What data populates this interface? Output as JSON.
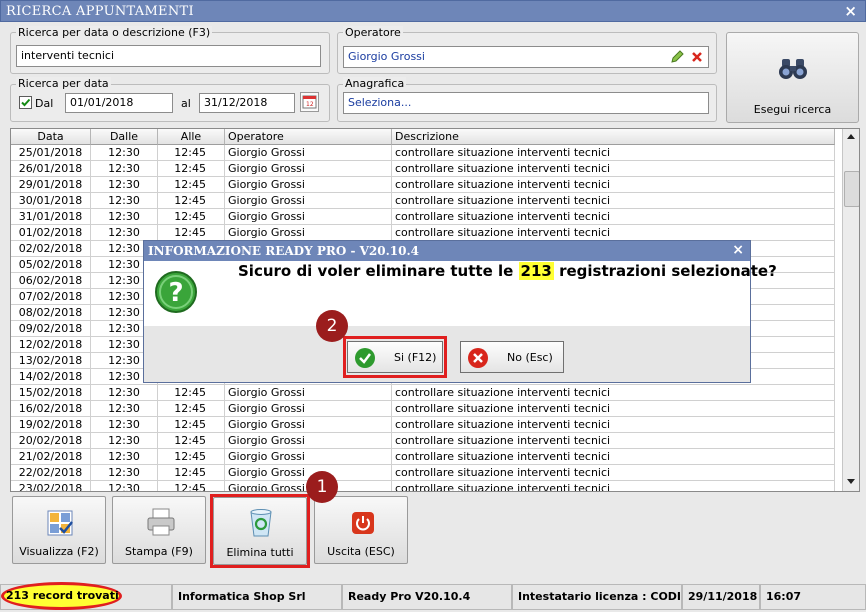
{
  "window": {
    "title": "RICERCA APPUNTAMENTI",
    "close": "×"
  },
  "search": {
    "desc_group_label": "Ricerca per data o descrizione (F3)",
    "desc_value": "interventi tecnici",
    "date_group_label": "Ricerca per data",
    "dal_label": "Dal",
    "dal_checked": true,
    "from_date": "01/01/2018",
    "al_label": "al",
    "to_date": "31/12/2018",
    "operator_group_label": "Operatore",
    "operator_value": "Giorgio Grossi",
    "anagrafica_group_label": "Anagrafica",
    "anagrafica_value": "Seleziona...",
    "execute_label": "Esegui ricerca"
  },
  "grid": {
    "columns": [
      "Data",
      "Dalle",
      "Alle",
      "Operatore",
      "Descrizione"
    ],
    "rows": [
      {
        "data": "25/01/2018",
        "dalle": "12:30",
        "alle": "12:45",
        "operatore": "Giorgio Grossi",
        "descrizione": "controllare situazione interventi tecnici"
      },
      {
        "data": "26/01/2018",
        "dalle": "12:30",
        "alle": "12:45",
        "operatore": "Giorgio Grossi",
        "descrizione": "controllare situazione interventi tecnici"
      },
      {
        "data": "29/01/2018",
        "dalle": "12:30",
        "alle": "12:45",
        "operatore": "Giorgio Grossi",
        "descrizione": "controllare situazione interventi tecnici"
      },
      {
        "data": "30/01/2018",
        "dalle": "12:30",
        "alle": "12:45",
        "operatore": "Giorgio Grossi",
        "descrizione": "controllare situazione interventi tecnici"
      },
      {
        "data": "31/01/2018",
        "dalle": "12:30",
        "alle": "12:45",
        "operatore": "Giorgio Grossi",
        "descrizione": "controllare situazione interventi tecnici"
      },
      {
        "data": "01/02/2018",
        "dalle": "12:30",
        "alle": "12:45",
        "operatore": "Giorgio Grossi",
        "descrizione": "controllare situazione interventi tecnici"
      },
      {
        "data": "02/02/2018",
        "dalle": "12:30",
        "alle": "",
        "operatore": "",
        "descrizione": ""
      },
      {
        "data": "05/02/2018",
        "dalle": "12:30",
        "alle": "",
        "operatore": "",
        "descrizione": ""
      },
      {
        "data": "06/02/2018",
        "dalle": "12:30",
        "alle": "",
        "operatore": "",
        "descrizione": ""
      },
      {
        "data": "07/02/2018",
        "dalle": "12:30",
        "alle": "",
        "operatore": "",
        "descrizione": ""
      },
      {
        "data": "08/02/2018",
        "dalle": "12:30",
        "alle": "",
        "operatore": "",
        "descrizione": ""
      },
      {
        "data": "09/02/2018",
        "dalle": "12:30",
        "alle": "",
        "operatore": "",
        "descrizione": ""
      },
      {
        "data": "12/02/2018",
        "dalle": "12:30",
        "alle": "",
        "operatore": "",
        "descrizione": ""
      },
      {
        "data": "13/02/2018",
        "dalle": "12:30",
        "alle": "",
        "operatore": "",
        "descrizione": ""
      },
      {
        "data": "14/02/2018",
        "dalle": "12:30",
        "alle": "",
        "operatore": "",
        "descrizione": ""
      },
      {
        "data": "15/02/2018",
        "dalle": "12:30",
        "alle": "12:45",
        "operatore": "Giorgio Grossi",
        "descrizione": "controllare situazione interventi tecnici"
      },
      {
        "data": "16/02/2018",
        "dalle": "12:30",
        "alle": "12:45",
        "operatore": "Giorgio Grossi",
        "descrizione": "controllare situazione interventi tecnici"
      },
      {
        "data": "19/02/2018",
        "dalle": "12:30",
        "alle": "12:45",
        "operatore": "Giorgio Grossi",
        "descrizione": "controllare situazione interventi tecnici"
      },
      {
        "data": "20/02/2018",
        "dalle": "12:30",
        "alle": "12:45",
        "operatore": "Giorgio Grossi",
        "descrizione": "controllare situazione interventi tecnici"
      },
      {
        "data": "21/02/2018",
        "dalle": "12:30",
        "alle": "12:45",
        "operatore": "Giorgio Grossi",
        "descrizione": "controllare situazione interventi tecnici"
      },
      {
        "data": "22/02/2018",
        "dalle": "12:30",
        "alle": "12:45",
        "operatore": "Giorgio Grossi",
        "descrizione": "controllare situazione interventi tecnici"
      },
      {
        "data": "23/02/2018",
        "dalle": "12:30",
        "alle": "12:45",
        "operatore": "Giorgio Grossi",
        "descrizione": "controllare situazione interventi tecnici"
      }
    ]
  },
  "dialog": {
    "title": "INFORMAZIONE READY PRO - V20.10.4",
    "close": "×",
    "message_before": "Sicuro di voler eliminare tutte le",
    "message_count": "213",
    "message_after": "registrazioni selezionate?",
    "yes_label": "Si (F12)",
    "no_label": "No (Esc)"
  },
  "annotations": {
    "step1": "1",
    "step2": "2",
    "highlight_color": "#e01f1f"
  },
  "toolbar": {
    "view_label": "Visualizza (F2)",
    "print_label": "Stampa (F9)",
    "delete_all_label": "Elimina tutti",
    "exit_label": "Uscita (ESC)"
  },
  "status": {
    "records": "213 record trovati",
    "company": "Informatica Shop Srl",
    "version": "Ready Pro V20.10.4",
    "license": "Intestatario licenza : CODICE",
    "date": "29/11/2018",
    "time": "16:07"
  },
  "colors": {
    "titlebar": "#6e86b8",
    "highlight_yellow": "#ffff33",
    "badge": "#9b1d1d"
  }
}
